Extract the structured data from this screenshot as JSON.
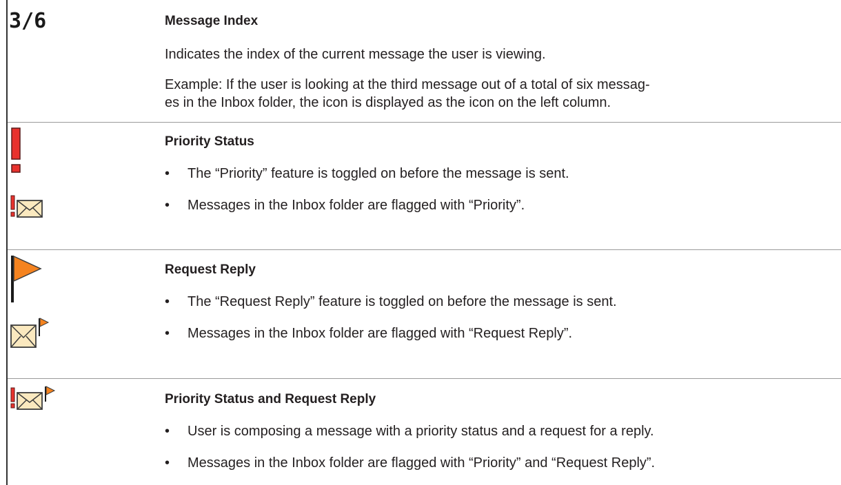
{
  "rows": [
    {
      "icon_text": "3/6",
      "icons": [
        "message-index-icon"
      ],
      "heading": "Message Index",
      "paragraphs": [
        "Indicates the index of the current message the user is viewing.",
        "Example: If the user is looking at the third message out of a total of six messag-",
        "es in the Inbox folder, the icon is displayed as the icon on the left column."
      ]
    },
    {
      "icons": [
        "priority-exclamation-icon",
        "priority-envelope-icon"
      ],
      "heading": "Priority Status",
      "bullets": [
        "The “Priority” feature is toggled on before the message is sent.",
        "Messages in the Inbox folder are flagged with “Priority”."
      ]
    },
    {
      "icons": [
        "request-reply-flag-icon",
        "request-reply-envelope-icon"
      ],
      "heading": "Request Reply",
      "bullets": [
        "The “Request Reply” feature is toggled on before the message is sent.",
        "Messages in the Inbox folder are flagged with “Request Reply”."
      ]
    },
    {
      "icons": [
        "priority-request-reply-envelope-icon"
      ],
      "heading": "Priority Status and Request Reply",
      "bullets": [
        "User is composing a message with a priority status and a request for a reply.",
        "Messages in the Inbox folder are flagged with “Priority” and “Request Reply”."
      ]
    }
  ],
  "bullet_char": "•",
  "colors": {
    "priority_red": "#e8322d",
    "flag_orange": "#f5831f",
    "envelope_fill": "#fbe9bf",
    "envelope_stroke": "#3c3c3c",
    "divider": "#999999",
    "text": "#231f20"
  }
}
